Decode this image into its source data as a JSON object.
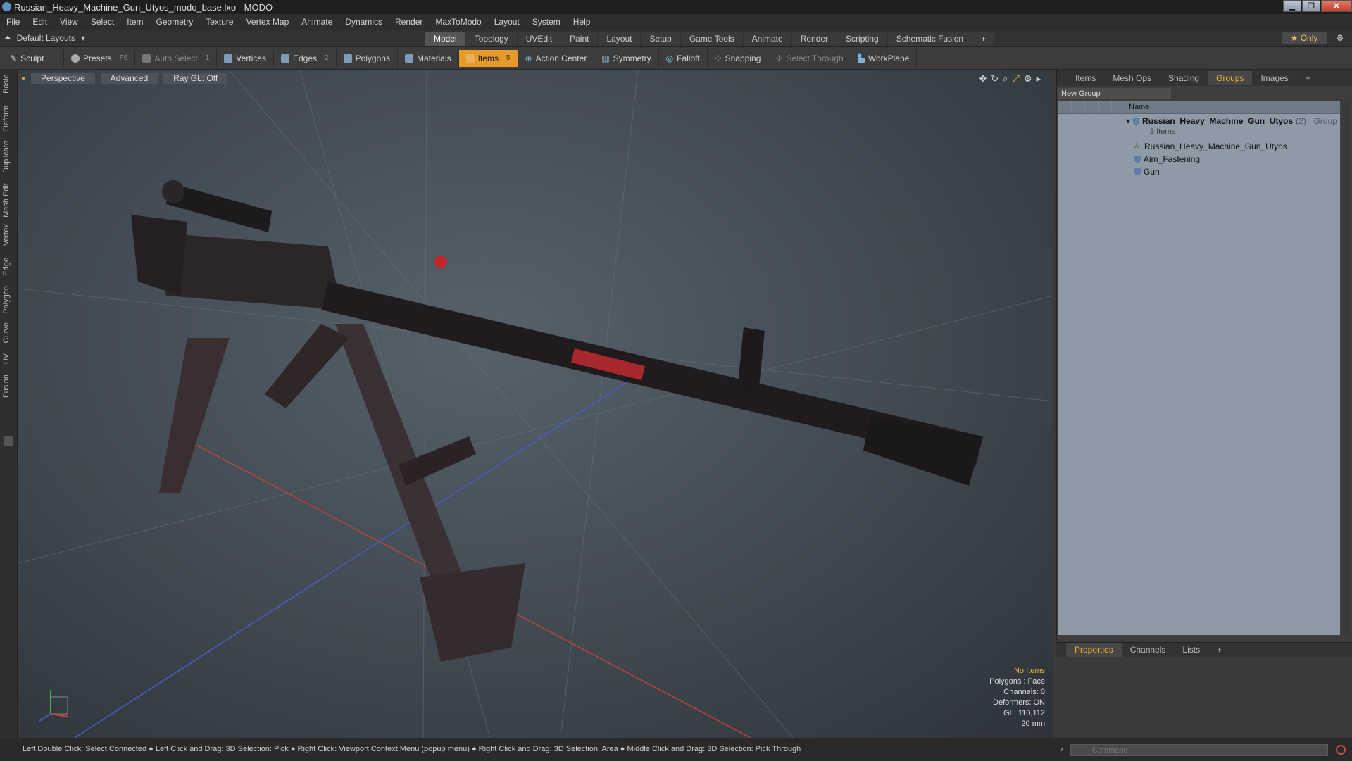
{
  "window": {
    "title": "Russian_Heavy_Machine_Gun_Utyos_modo_base.lxo - MODO"
  },
  "menu": [
    "File",
    "Edit",
    "View",
    "Select",
    "Item",
    "Geometry",
    "Texture",
    "Vertex Map",
    "Animate",
    "Dynamics",
    "Render",
    "MaxToModo",
    "Layout",
    "System",
    "Help"
  ],
  "layoutbar": {
    "layouts_label": "Default Layouts",
    "tabs": [
      "Model",
      "Topology",
      "UVEdit",
      "Paint",
      "Layout",
      "Setup",
      "Game Tools",
      "Animate",
      "Render",
      "Scripting",
      "Schematic Fusion"
    ],
    "add_tab": "+",
    "only_label": "Only"
  },
  "toolbar": {
    "sculpt": "Sculpt",
    "presets": "Presets",
    "presets_shortcut": "F6",
    "auto_select": "Auto Select",
    "vertices": "Vertices",
    "vertices_count": "1",
    "edges": "Edges",
    "edges_count": "2",
    "polygons": "Polygons",
    "materials": "Materials",
    "items": "Items",
    "items_count": "5",
    "action_center": "Action Center",
    "symmetry": "Symmetry",
    "falloff": "Falloff",
    "snapping": "Snapping",
    "select_through": "Select Through",
    "workplane": "WorkPlane"
  },
  "left_tabs": [
    "Basic",
    "Deform",
    "Duplicate",
    "Mesh Edit",
    "Vertex",
    "Edge",
    "Polygon",
    "Curve",
    "UV",
    "Fusion"
  ],
  "viewport": {
    "view": "Perspective",
    "shading": "Advanced",
    "raygl": "Ray GL: Off",
    "stats": {
      "selection": "No Items",
      "polygons": "Polygons : Face",
      "channels": "Channels: 0",
      "deformers": "Deformers: ON",
      "gl": "GL: 110,112",
      "size": "20 mm"
    }
  },
  "right_panel": {
    "tabs": [
      "Items",
      "Mesh Ops",
      "Shading",
      "Groups",
      "Images"
    ],
    "add_tab": "+",
    "new_group": "New Group",
    "name_col": "Name",
    "group": {
      "name": "Russian_Heavy_Machine_Gun_Utyos",
      "count": "(2)",
      "type": ": Group",
      "items_count": "3 Items",
      "children": [
        "Russian_Heavy_Machine_Gun_Utyos",
        "Aim_Fastening",
        "Gun"
      ]
    }
  },
  "properties": {
    "tabs": [
      "Properties",
      "Channels",
      "Lists"
    ],
    "add_tab": "+"
  },
  "status": {
    "text": "Left Double Click: Select Connected ● Left Click and Drag: 3D Selection: Pick ● Right Click: Viewport Context Menu (popup menu) ● Right Click and Drag: 3D Selection: Area ● Middle Click and Drag: 3D Selection: Pick Through"
  },
  "command": {
    "placeholder": "Command"
  },
  "colors": {
    "accent": "#e59a2b",
    "groups_list": "#8e9aa6"
  }
}
